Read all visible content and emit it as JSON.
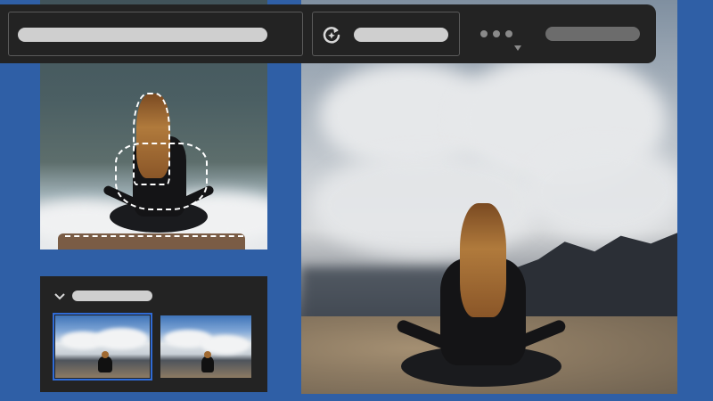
{
  "colors": {
    "background": "#2f5fa6",
    "toolbar_bg": "#232323",
    "pill": "#cfcfcf",
    "pill_dim": "#6c6c6c",
    "selection_border": "#2f6bd6"
  },
  "toolbar": {
    "input_placeholder_icon": "text-field",
    "generate_icon": "sparkle-refresh-icon",
    "more_icon": "more-dots-icon",
    "dropdown_icon": "caret-down-icon"
  },
  "panels": {
    "layers": {
      "expand_icon": "chevron-down-icon",
      "thumbnail_count": 2,
      "selected_index": 0
    }
  }
}
